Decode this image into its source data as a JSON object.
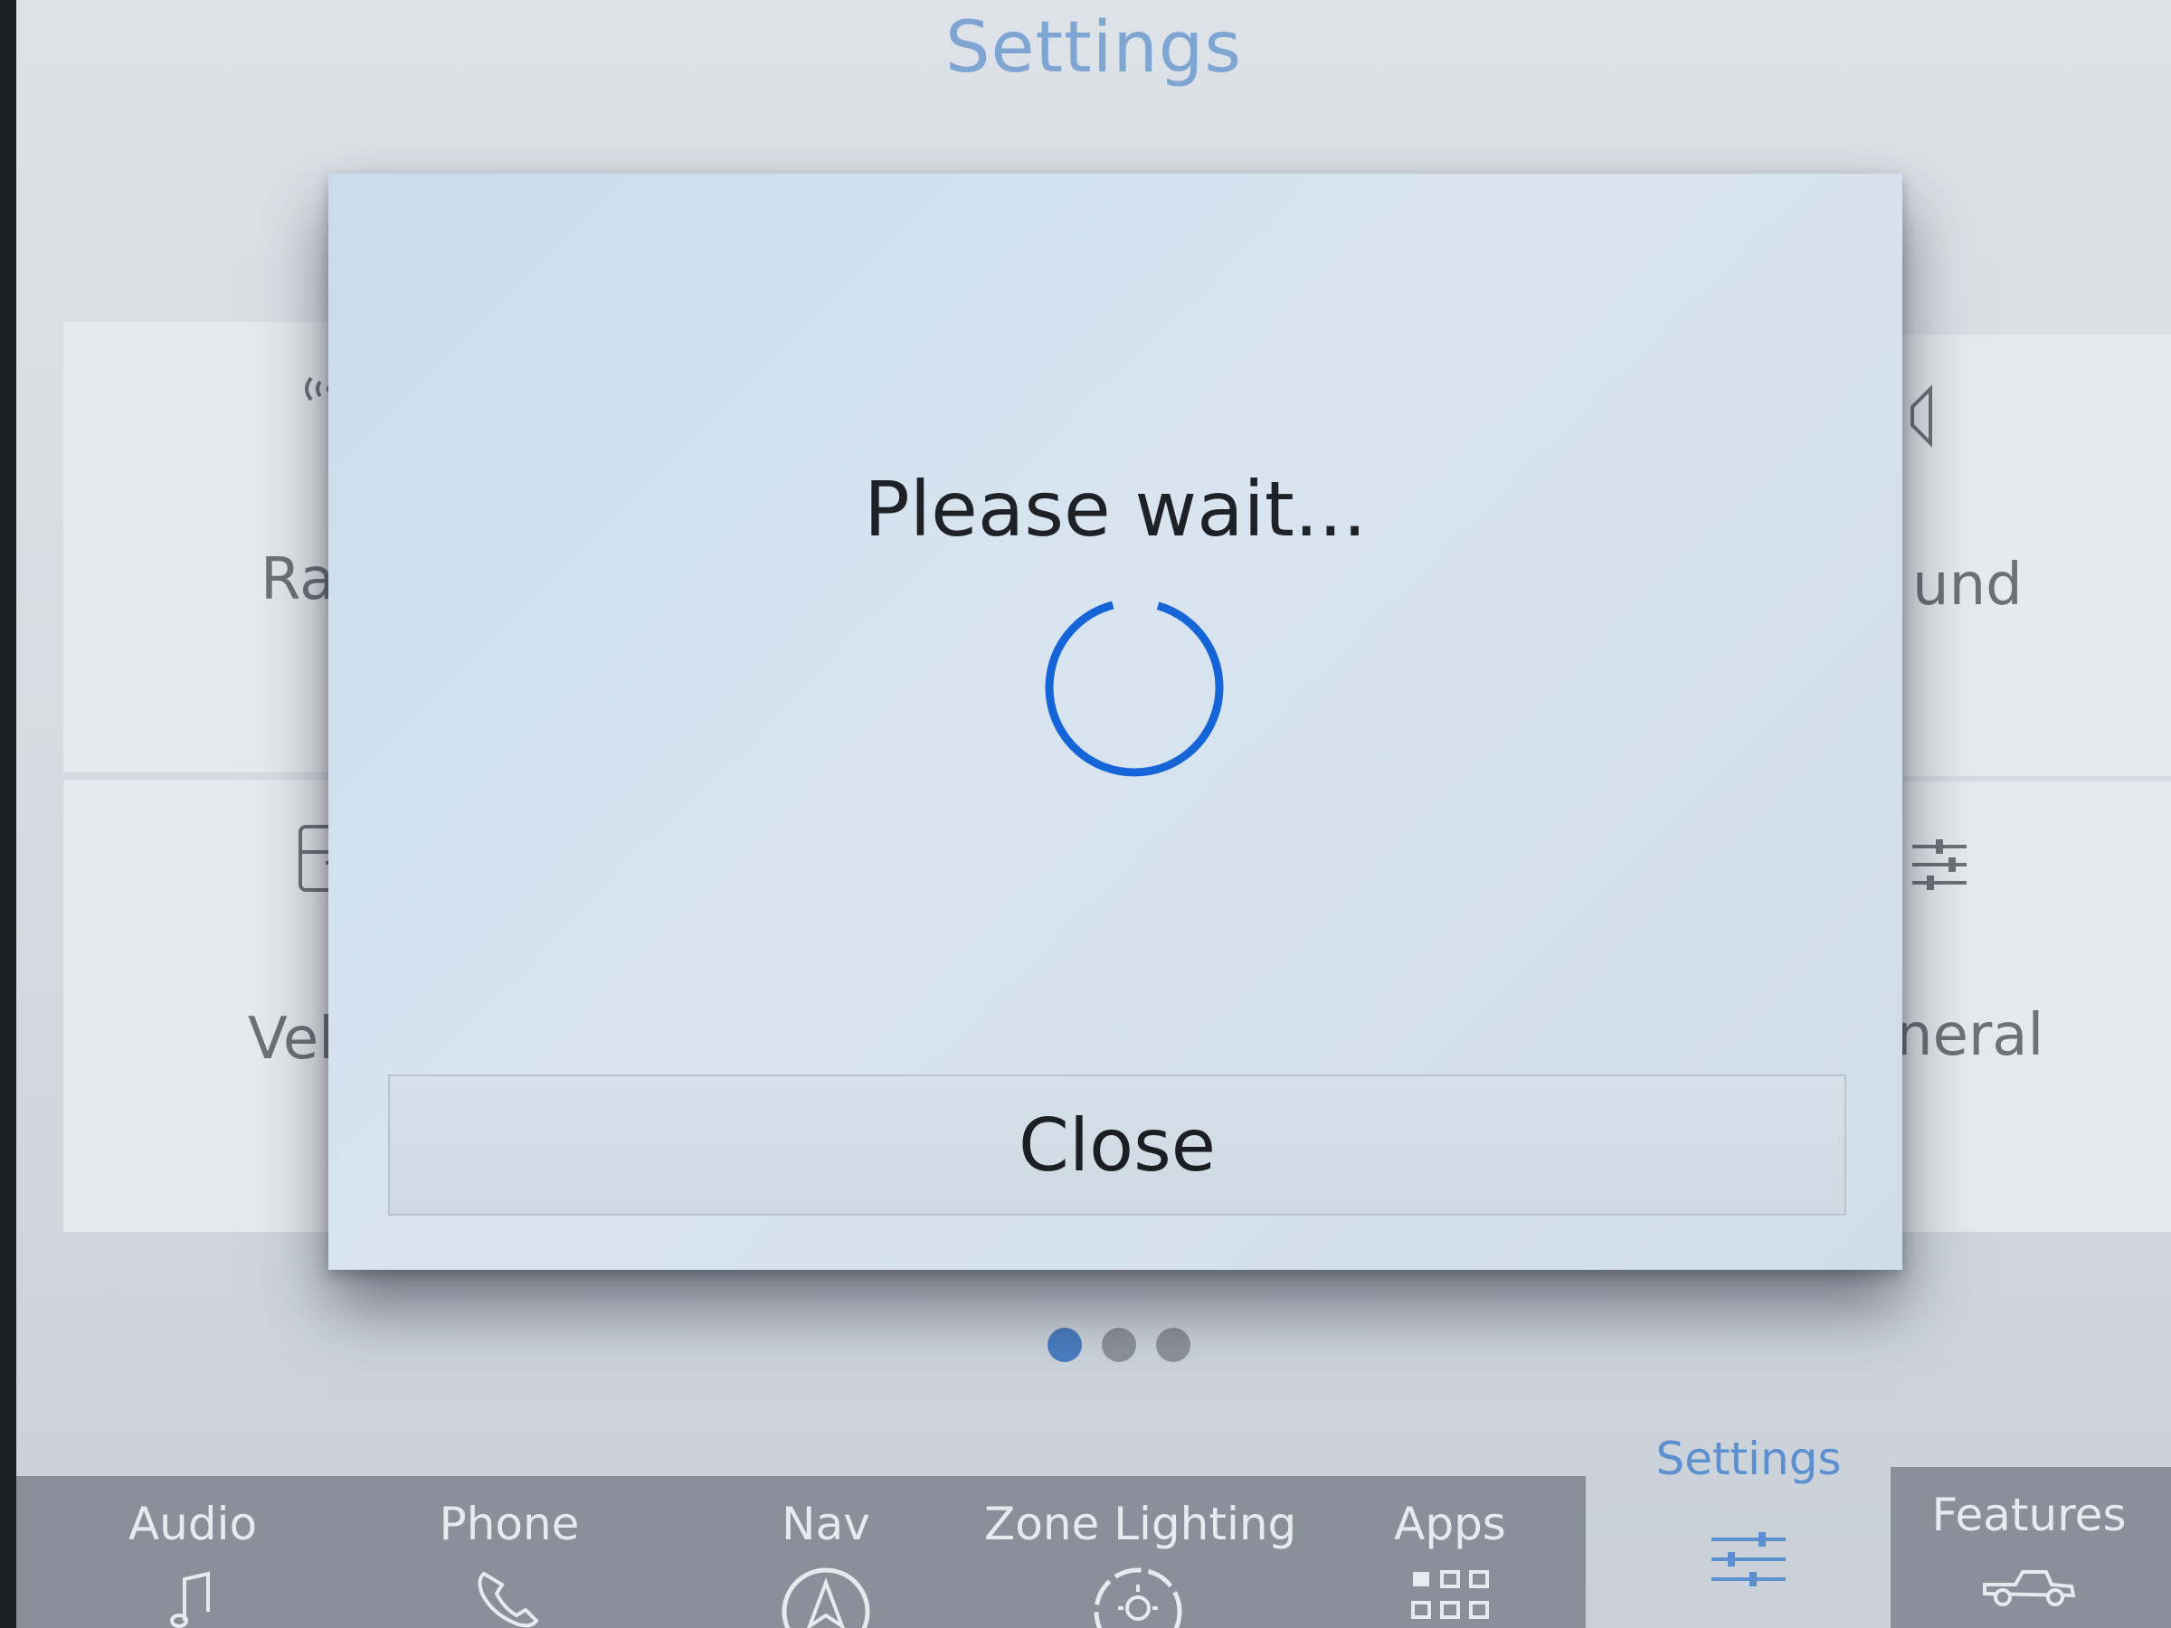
{
  "screen": {
    "title": "Settings"
  },
  "tiles": {
    "radio_label": "Rad",
    "sound_label": "und",
    "vehicle_label": "Veh",
    "general_label": "neral"
  },
  "pagination": {
    "pages": 3,
    "active": 1
  },
  "dialog": {
    "message": "Please wait...",
    "close_label": "Close",
    "spinner_color": "#1565d8"
  },
  "bottom_nav": {
    "items": [
      {
        "label": "Audio",
        "icon": "music-note-icon"
      },
      {
        "label": "Phone",
        "icon": "phone-icon"
      },
      {
        "label": "Nav",
        "icon": "navigation-icon"
      },
      {
        "label": "Zone Lighting",
        "icon": "zone-lighting-icon"
      },
      {
        "label": "Apps",
        "icon": "apps-grid-icon"
      },
      {
        "label": "Settings",
        "icon": "settings-sliders-icon",
        "active": true
      },
      {
        "label": "Features",
        "icon": "truck-icon"
      }
    ]
  },
  "colors": {
    "accent": "#4a7dc2",
    "title": "#7fa6d3"
  }
}
